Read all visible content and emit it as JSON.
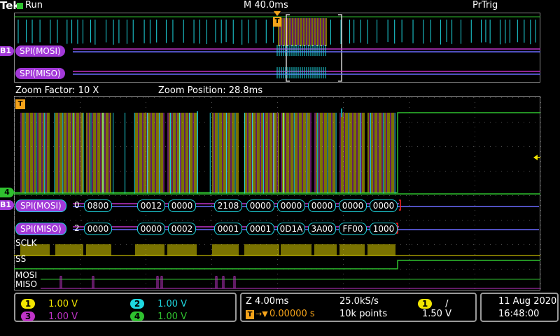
{
  "brand": "Tek",
  "run_state": "Run",
  "timebase": "M 40.0ms",
  "trigger_mode": "PrTrig",
  "zoom": {
    "factor": "Zoom Factor: 10 X",
    "position": "Zoom Position: 28.8ms"
  },
  "bus": {
    "b1_marker": "B1",
    "mosi_label": "SPI(MOSI)",
    "miso_label": "SPI(MISO)",
    "mosi_lead": "0",
    "miso_lead": "2",
    "mosi_packets": [
      "0800",
      "0012",
      "0000",
      "2108",
      "0000",
      "0000",
      "0000",
      "0000",
      "0000"
    ],
    "miso_packets": [
      "0000",
      "0000",
      "0002",
      "0001",
      "0001",
      "0D1A",
      "3A00",
      "FF00",
      "1000"
    ]
  },
  "digital": {
    "sclk": "SCLK",
    "ss": "SS",
    "mosi": "MOSI",
    "miso": "MISO"
  },
  "ch4_marker": "4",
  "trigger_marker": "T",
  "channels": [
    {
      "num": "1",
      "scale": "1.00 V",
      "color": "#f3e600"
    },
    {
      "num": "2",
      "scale": "1.00 V",
      "color": "#1ed8e0"
    },
    {
      "num": "3",
      "scale": "1.00 V",
      "color": "#c033c8"
    },
    {
      "num": "4",
      "scale": "1.00 V",
      "color": "#2fc12f"
    }
  ],
  "acq": {
    "zoom_time": "Z 4.00ms",
    "sample_rate": "25.0kS/s",
    "trig_offset": "0.00000 s",
    "record": "10k points",
    "trig_source": "1",
    "trig_slope": "/",
    "trig_level": "1.50 V"
  },
  "datetime": {
    "date": "11 Aug 2020",
    "time": "16:48:00"
  }
}
